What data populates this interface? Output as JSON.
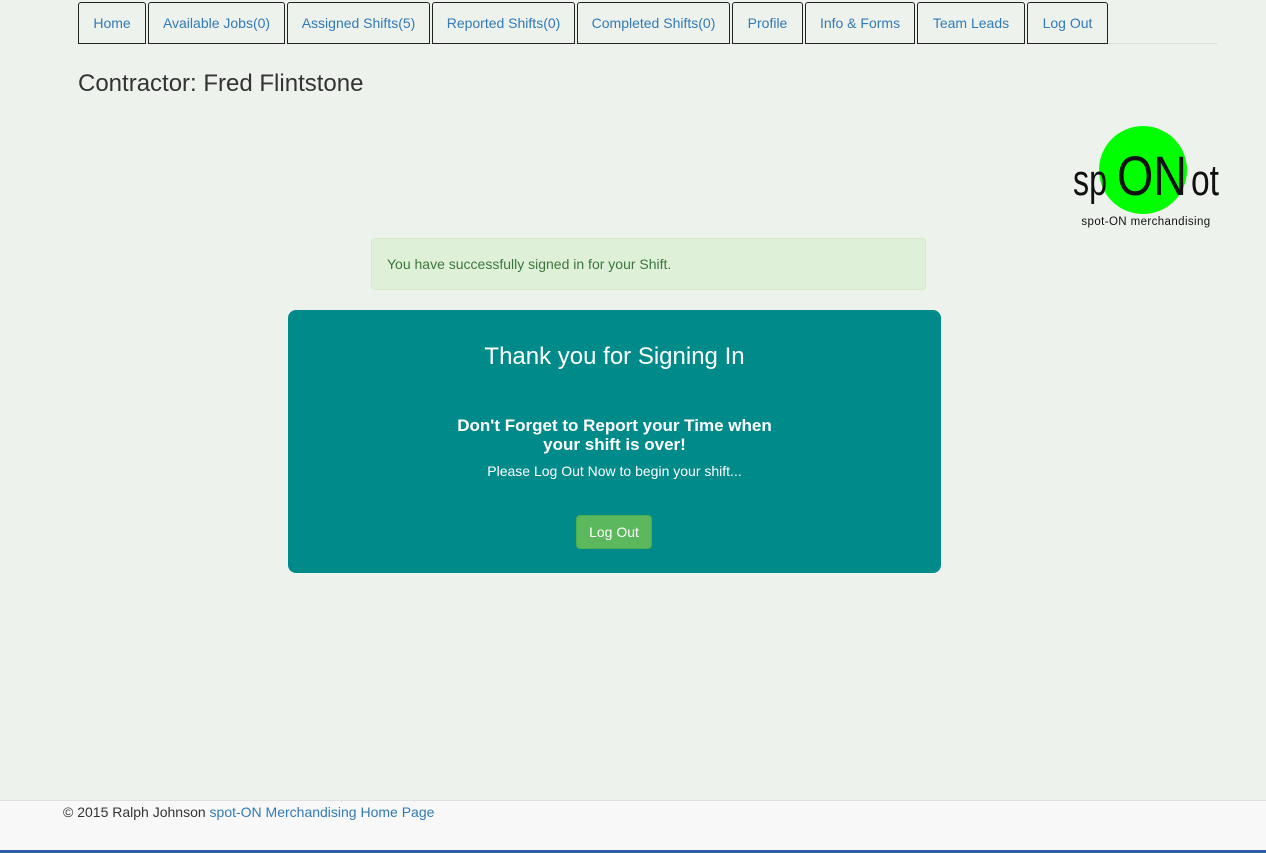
{
  "nav": {
    "tabs": [
      {
        "label": "Home"
      },
      {
        "label": "Available Jobs(0)"
      },
      {
        "label": "Assigned Shifts(5)"
      },
      {
        "label": "Reported Shifts(0)"
      },
      {
        "label": "Completed Shifts(0)"
      },
      {
        "label": "Profile"
      },
      {
        "label": "Info & Forms"
      },
      {
        "label": "Team Leads"
      },
      {
        "label": "Log Out"
      }
    ]
  },
  "page": {
    "title": "Contractor: Fred Flintstone"
  },
  "logo": {
    "left_text": "sp",
    "circle_text": "ON",
    "right_text": "ot",
    "tagline": "spot-ON merchandising",
    "circle_color": "#00ff00"
  },
  "alert": {
    "message": "You have successfully signed in for your Shift."
  },
  "panel": {
    "heading": "Thank you for Signing In",
    "reminder": "Don't Forget to Report your Time when your shift is over!",
    "note": "Please Log Out Now to begin your shift...",
    "button_label": "Log Out",
    "background_color": "#008a8a",
    "button_color": "#5cb85c"
  },
  "footer": {
    "copyright": "© 2015 Ralph Johnson",
    "link_text": "spot-ON Merchandising Home Page"
  }
}
